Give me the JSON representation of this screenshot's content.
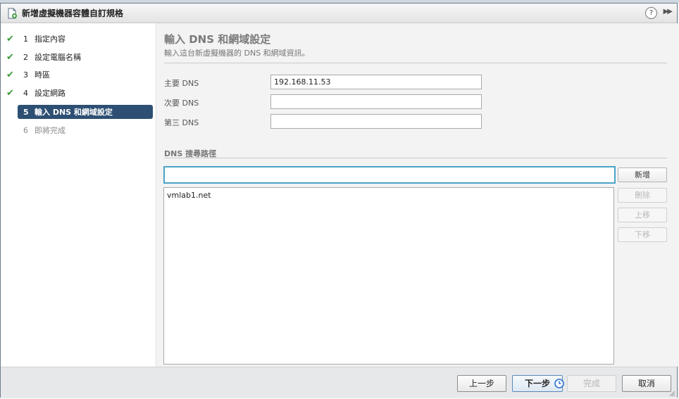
{
  "window": {
    "title": "新增虛擬機器容體自訂規格",
    "help_label": "?",
    "expand_label": "▶▶"
  },
  "steps": [
    {
      "number": "1",
      "label": "指定內容",
      "state": "done"
    },
    {
      "number": "2",
      "label": "設定電腦名稱",
      "state": "done"
    },
    {
      "number": "3",
      "label": "時區",
      "state": "done"
    },
    {
      "number": "4",
      "label": "設定網路",
      "state": "done"
    },
    {
      "number": "5",
      "label": "輸入 DNS 和網域設定",
      "state": "active"
    },
    {
      "number": "6",
      "label": "即將完成",
      "state": "pending"
    }
  ],
  "page": {
    "heading": "輸入 DNS 和網域設定",
    "subheading": "輸入這台新虛擬機器的 DNS 和網域資訊。"
  },
  "dns": {
    "primary_label": "主要 DNS",
    "primary_value": "192.168.11.53",
    "secondary_label": "次要 DNS",
    "secondary_value": "",
    "tertiary_label": "第三 DNS",
    "tertiary_value": ""
  },
  "search_path": {
    "section_title": "DNS 搜尋路徑",
    "input_value": "",
    "items": [
      "vmlab1.net"
    ],
    "buttons": {
      "add": "新增",
      "remove": "刪除",
      "move_up": "上移",
      "move_down": "下移"
    }
  },
  "footer": {
    "back": "上一步",
    "next": "下一步",
    "finish": "完成",
    "cancel": "取消"
  },
  "colors": {
    "active_step": "#2d4f73",
    "check": "#3a9a3a",
    "focus": "#4aa3c8"
  }
}
